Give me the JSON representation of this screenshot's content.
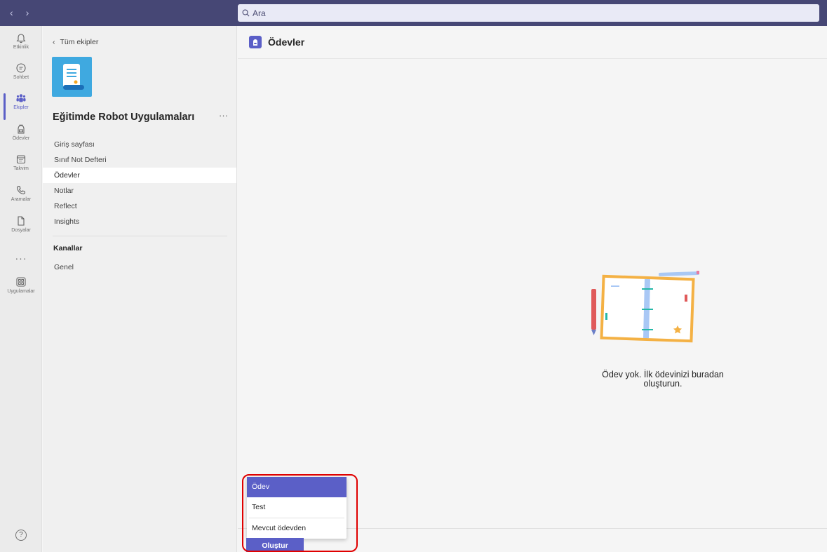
{
  "topbar": {
    "back_glyph": "‹",
    "forward_glyph": "›",
    "search_placeholder": "Ara"
  },
  "rail": {
    "items": [
      {
        "label": "Etkinlik",
        "icon": "bell-icon"
      },
      {
        "label": "Sohbet",
        "icon": "chat-icon"
      },
      {
        "label": "Ekipler",
        "icon": "teams-icon"
      },
      {
        "label": "Ödevler",
        "icon": "backpack-icon"
      },
      {
        "label": "Takvim",
        "icon": "calendar-icon"
      },
      {
        "label": "Aramalar",
        "icon": "phone-icon"
      },
      {
        "label": "Dosyalar",
        "icon": "file-icon"
      },
      {
        "label": "Uygulamalar",
        "icon": "apps-icon"
      }
    ],
    "more": "···",
    "help": "?"
  },
  "team_panel": {
    "back_label": "Tüm ekipler",
    "team_name": "Eğitimde Robot Uygulamaları",
    "more": "···",
    "nav": [
      "Giriş sayfası",
      "Sınıf Not Defteri",
      "Ödevler",
      "Notlar",
      "Reflect",
      "Insights"
    ],
    "selected_nav": "Ödevler",
    "channels_heading": "Kanallar",
    "channels": [
      "Genel"
    ]
  },
  "main": {
    "title": "Ödevler",
    "empty_line1": "Ödev yok. İlk ödevinizi buradan",
    "empty_line2": "oluşturun."
  },
  "popup": {
    "items": [
      "Ödev",
      "Test",
      "Mevcut ödevden"
    ],
    "highlighted": "Ödev"
  },
  "create_button": "Oluştur",
  "colors": {
    "accent": "#5b5fc7",
    "topbar": "#464775",
    "highlight": "#e00000"
  }
}
